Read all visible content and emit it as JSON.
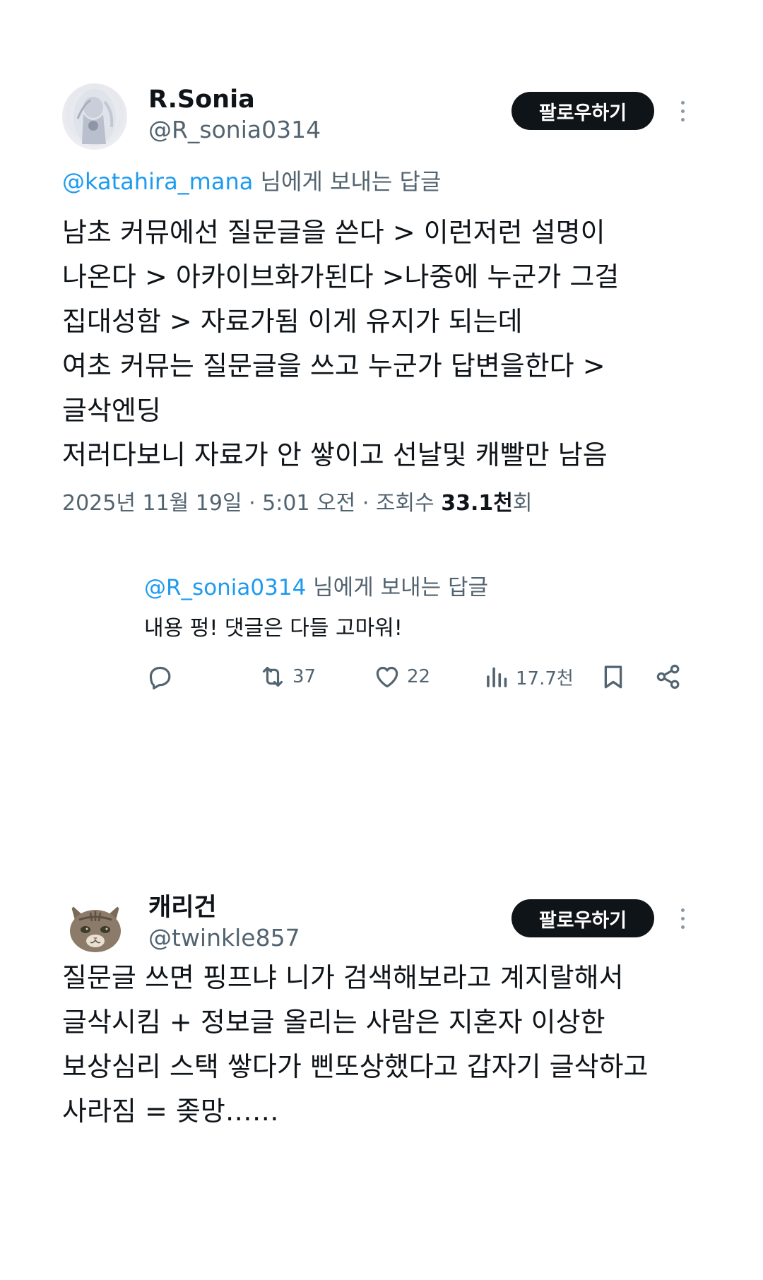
{
  "post1": {
    "display_name": "R.Sonia",
    "handle": "@R_sonia0314",
    "follow_label": "팔로우하기",
    "reply_to": {
      "mention": "@katahira_mana",
      "suffix": " 님에게 보내는 답글"
    },
    "body": "남초 커뮤에선 질문글을 쓴다 > 이런저런 설명이\n나온다 > 아카이브화가된다 >나중에 누군가 그걸\n집대성함 > 자료가됨 이게 유지가 되는데\n여초 커뮤는 질문글을 쓰고 누군가 답변을한다 >\n글삭엔딩\n저러다보니 자료가 안 쌓이고 선날및 캐빨만 남음",
    "meta": {
      "date_time": "2025년 11월 19일 · 5:01 오전 · 조회수 ",
      "views": "33.1천",
      "views_suffix": "회"
    },
    "self_reply": {
      "mention": "@R_sonia0314",
      "suffix": " 님에게 보내는 답글",
      "text": "내용 펑! 댓글은 다들 고마워!",
      "actions": {
        "retweets": "37",
        "likes": "22",
        "views": "17.7천"
      }
    }
  },
  "post2": {
    "display_name": "캐리건",
    "handle": "@twinkle857",
    "follow_label": "팔로우하기",
    "body": "질문글 쓰면 핑프냐 니가 검색해보라고 계지랄해서\n글삭시킴 + 정보글 올리는 사람은 지혼자 이상한\n보상심리 스택 쌓다가 삔또상했다고 갑자기 글삭하고\n사라짐 = 좆망……"
  },
  "colors": {
    "text": "#0f1419",
    "secondary": "#536471",
    "link": "#1d9bf0",
    "button_bg": "#0f1419",
    "button_text": "#ffffff"
  },
  "icons": {
    "reply": "reply-bubble-icon",
    "retweet": "retweet-icon",
    "like": "heart-icon",
    "views": "bar-chart-icon",
    "bookmark": "bookmark-icon",
    "share": "share-icon",
    "more": "more-dots-icon"
  }
}
